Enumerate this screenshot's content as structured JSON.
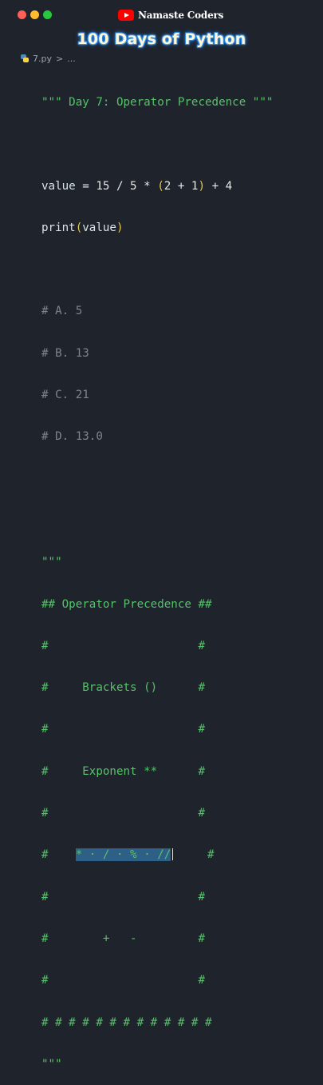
{
  "window": {
    "channel_name": "Namaste Coders",
    "channel_icon": "youtube-icon"
  },
  "banner": {
    "title": "100 Days of Python"
  },
  "breadcrumb": {
    "file": "7.py",
    "separator": ">",
    "ellipsis": "..."
  },
  "code": {
    "docstring_header": "\"\"\" Day 7: Operator Precedence \"\"\"",
    "expr": {
      "var": "value",
      "eq": " = 15 / 5 * ",
      "open": "(",
      "inner": "2 + 1",
      "close": ")",
      "tail": " + 4"
    },
    "print": {
      "fn": "print",
      "open": "(",
      "arg": "value",
      "close": ")"
    },
    "options": [
      "# A. 5",
      "# B. 13",
      "# C. 21",
      "# D. 13.0"
    ],
    "box_open": "\"\"\"",
    "box_title": "## Operator Precedence ##",
    "box_lines": [
      "#                      #",
      "#     Brackets ()      #",
      "#                      #",
      "#     Exponent **      #",
      "#                      #"
    ],
    "row_ops": {
      "prefix": "#    ",
      "selected": "* · / · % · //",
      "suffix": "     #"
    },
    "box_lines_after": [
      "#                      #",
      "#        +   -         #",
      "#                      #"
    ],
    "box_bottom": "# # # # # # # # # # # # #",
    "box_close": "\"\"\""
  }
}
